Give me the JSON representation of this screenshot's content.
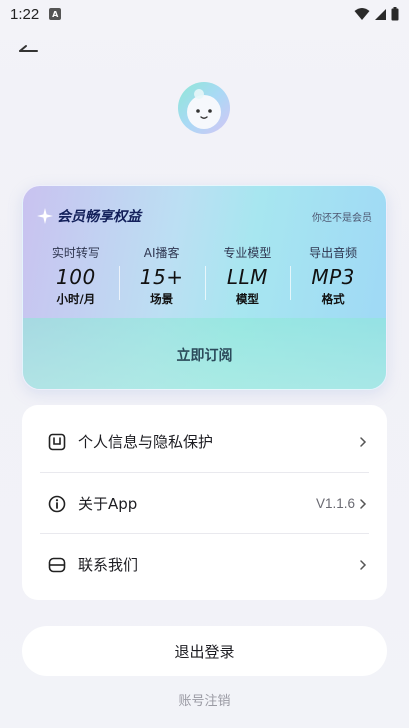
{
  "status_bar": {
    "time": "1:22",
    "notification_badge": "A"
  },
  "vip_card": {
    "title": "会员畅享权益",
    "status": "你还不是会员",
    "benefits": [
      {
        "label": "实时转写",
        "value": "100",
        "unit": "小时/月"
      },
      {
        "label": "AI播客",
        "value": "15+",
        "unit": "场景"
      },
      {
        "label": "专业模型",
        "value": "LLM",
        "unit": "模型"
      },
      {
        "label": "导出音频",
        "value": "MP3",
        "unit": "格式"
      }
    ],
    "subscribe_label": "立即订阅"
  },
  "menu": {
    "items": [
      {
        "label": "个人信息与隐私保护",
        "value": ""
      },
      {
        "label": "关于App",
        "value": "V1.1.6"
      },
      {
        "label": "联系我们",
        "value": ""
      }
    ]
  },
  "logout_label": "退出登录",
  "cancel_account_label": "账号注销",
  "colors": {
    "accent_title": "#13205a",
    "card_bg": "#ffffff",
    "page_bg": "#f2f2f7"
  },
  "icons": [
    "back-arrow-icon",
    "wifi-icon",
    "signal-icon",
    "battery-icon",
    "sparkle-icon",
    "privacy-icon",
    "info-icon",
    "contact-icon",
    "chevron-right-icon"
  ]
}
